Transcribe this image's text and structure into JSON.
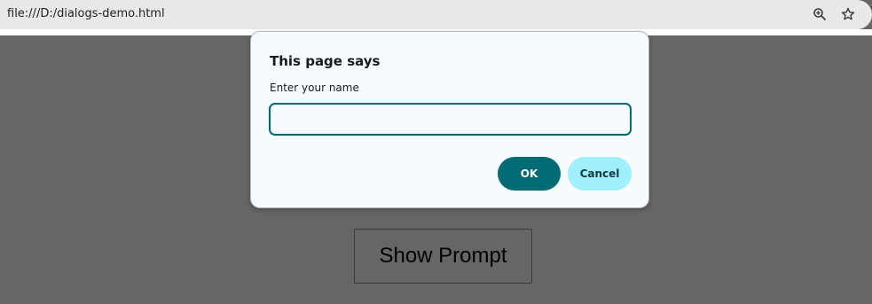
{
  "browser": {
    "url": "file:///D:/dialogs-demo.html",
    "icons": [
      "zoom-icon",
      "star-icon"
    ]
  },
  "page": {
    "button_label": "Show Prompt"
  },
  "dialog": {
    "title": "This page says",
    "message": "Enter your name",
    "input_value": "",
    "ok_label": "OK",
    "cancel_label": "Cancel"
  },
  "colors": {
    "overlay": "#666666",
    "dialog_bg": "#f5fbff",
    "accent": "#006b74",
    "cancel_bg": "#9feffc"
  }
}
